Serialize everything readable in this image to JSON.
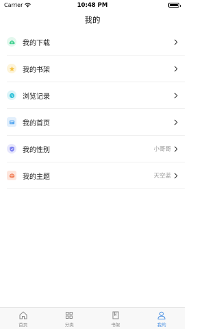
{
  "status_bar": {
    "carrier": "Carrier",
    "time": "10:48 PM"
  },
  "nav": {
    "title": "我的"
  },
  "menu": {
    "items": [
      {
        "label": "我的下载",
        "value": "",
        "color": "#3dcf8e",
        "bg": "#e3f8ee",
        "icon": "download-icon"
      },
      {
        "label": "我的书架",
        "value": "",
        "color": "#f5c242",
        "bg": "#fdf4da",
        "icon": "star-icon"
      },
      {
        "label": "浏览记录",
        "value": "",
        "color": "#35c3d9",
        "bg": "#dcf4f8",
        "icon": "history-icon"
      },
      {
        "label": "我的首页",
        "value": "",
        "color": "#5aa9f0",
        "bg": "#e2effc",
        "icon": "homepage-icon"
      },
      {
        "label": "我的性别",
        "value": "小哥哥",
        "color": "#7a7ef0",
        "bg": "#e7e7fc",
        "icon": "gender-shield-icon"
      },
      {
        "label": "我的主题",
        "value": "天空蓝",
        "color": "#f07a52",
        "bg": "#fde6dd",
        "icon": "theme-icon"
      }
    ]
  },
  "tabbar": {
    "tabs": [
      {
        "label": "首页",
        "icon": "home-icon",
        "active": false
      },
      {
        "label": "分类",
        "icon": "category-icon",
        "active": false
      },
      {
        "label": "书架",
        "icon": "bookshelf-icon",
        "active": false
      },
      {
        "label": "我的",
        "icon": "profile-icon",
        "active": true
      }
    ],
    "active_color": "#4a90e2",
    "inactive_color": "#888888"
  }
}
